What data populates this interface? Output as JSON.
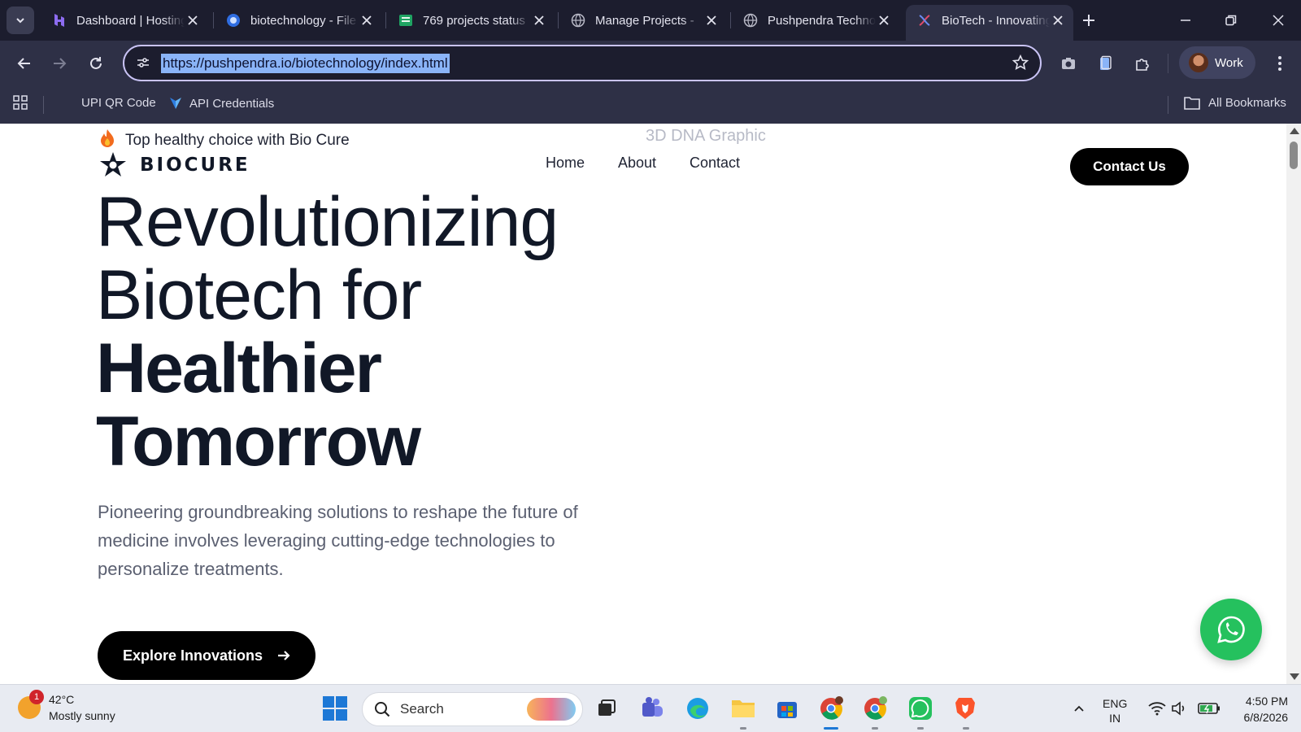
{
  "browser": {
    "tabs": [
      {
        "title": "Dashboard | Hostinger",
        "icon": "hostinger-icon",
        "active": false
      },
      {
        "title": "biotechnology - File Manager",
        "icon": "globe-blue-icon",
        "active": false
      },
      {
        "title": "769 projects status",
        "icon": "sheets-icon",
        "active": false
      },
      {
        "title": "Manage Projects - ",
        "icon": "globe-icon",
        "active": false
      },
      {
        "title": "Pushpendra Technologies",
        "icon": "globe-icon",
        "active": false
      },
      {
        "title": "BioTech - Innovating",
        "icon": "dna-icon",
        "active": true
      }
    ],
    "url": "https://pushpendra.io/biotechnology/index.html",
    "profile_label": "Work",
    "bookmarks": [
      {
        "label": "UPI QR Code"
      },
      {
        "label": "API Credentials"
      }
    ],
    "all_bookmarks_label": "All Bookmarks"
  },
  "page": {
    "tagline": "Top healthy choice with Bio Cure",
    "brand": "BIOCURE",
    "dna_graphic_alt": "3D DNA Graphic",
    "nav": [
      "Home",
      "About",
      "Contact"
    ],
    "contact_button": "Contact Us",
    "hero": {
      "line1": "Revolutionizing",
      "line2": "Biotech for",
      "line3": "Healthier",
      "line4": "Tomorrow"
    },
    "subtitle": "Pioneering groundbreaking solutions to reshape the future of medicine involves leveraging cutting-edge technologies to personalize treatments.",
    "explore_button": "Explore Innovations"
  },
  "taskbar": {
    "weather_badge": "1",
    "temperature": "42°C",
    "weather_text": "Mostly sunny",
    "search_placeholder": "Search",
    "language_top": "ENG",
    "language_bottom": "IN",
    "time": "4:50 PM",
    "date": "6/8/2026"
  },
  "colors": {
    "accent_whatsapp": "#25c15e",
    "omnibox_border": "#c9c3f5",
    "url_highlight": "#8ab4f8",
    "brand_dark": "#111827"
  }
}
